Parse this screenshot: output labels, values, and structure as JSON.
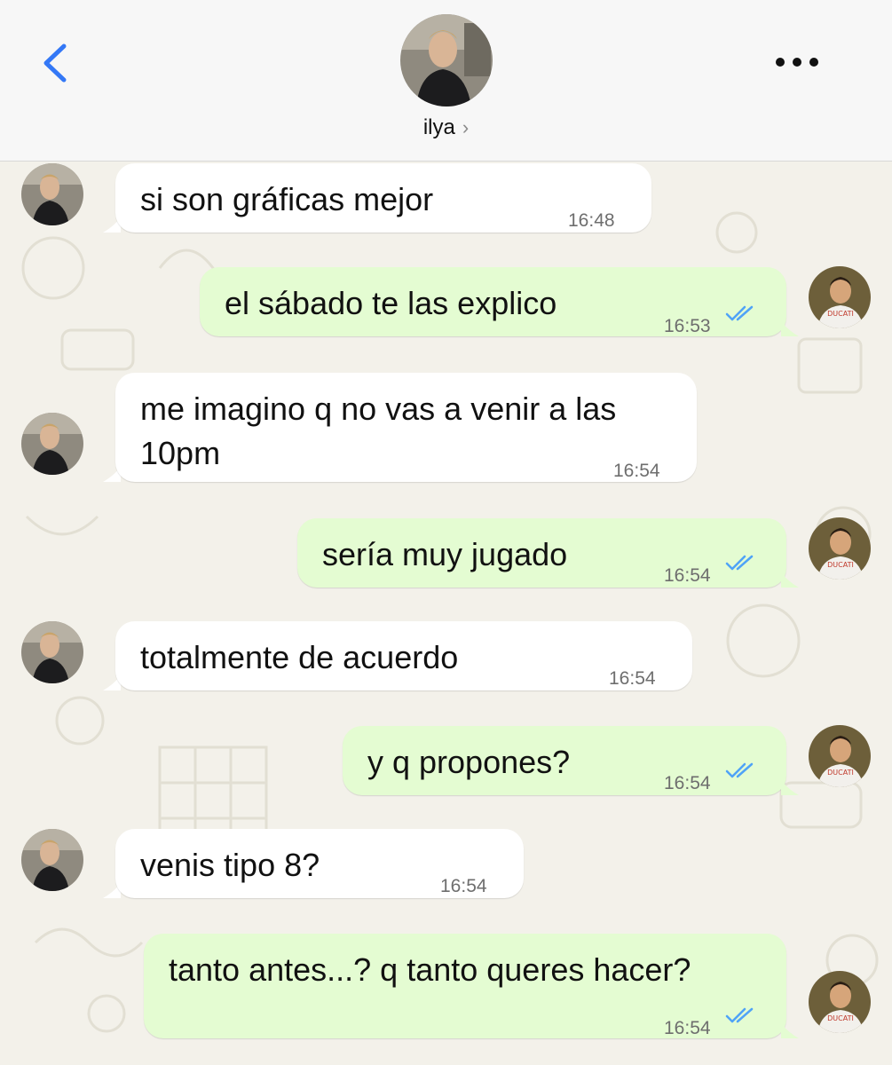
{
  "contact": {
    "name": "ilya"
  },
  "messages": [
    {
      "direction": "incoming",
      "text": "si son gráficas mejor",
      "time": "16:48"
    },
    {
      "direction": "outgoing",
      "text": "el sábado te las explico",
      "time": "16:53"
    },
    {
      "direction": "incoming",
      "text": "me imagino q no vas a venir a las 10pm",
      "time": "16:54"
    },
    {
      "direction": "outgoing",
      "text": "sería muy jugado",
      "time": "16:54"
    },
    {
      "direction": "incoming",
      "text": "totalmente de acuerdo",
      "time": "16:54"
    },
    {
      "direction": "outgoing",
      "text": "y q propones?",
      "time": "16:54"
    },
    {
      "direction": "incoming",
      "text": "venis tipo 8?",
      "time": "16:54"
    },
    {
      "direction": "outgoing",
      "text": "tanto antes...? q tanto queres hacer?",
      "time": "16:54"
    }
  ],
  "avatar_shirt_text": "DUCATI",
  "colors": {
    "accent": "#3478f6",
    "incoming_bubble": "#ffffff",
    "outgoing_bubble": "#e4fcd2",
    "read_ticks": "#4fa3f7",
    "wallpaper": "#f3f1ea"
  }
}
